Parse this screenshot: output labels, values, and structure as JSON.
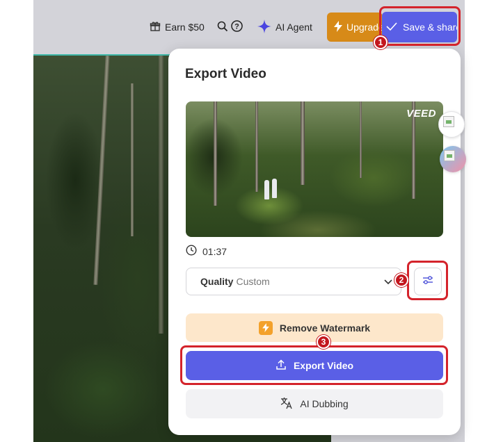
{
  "topbar": {
    "earn_label": "Earn $50",
    "ai_agent_label": "AI Agent",
    "upgrade_label": "Upgrade",
    "save_share_label": "Save & share"
  },
  "export_panel": {
    "title": "Export Video",
    "watermark_text": "VEED",
    "duration": "01:37",
    "quality_label": "Quality",
    "quality_value": "Custom",
    "remove_watermark_label": "Remove Watermark",
    "export_button_label": "Export Video",
    "ai_dubbing_label": "AI Dubbing"
  },
  "annotations": {
    "step1": "1",
    "step2": "2",
    "step3": "3"
  },
  "colors": {
    "accent": "#5a5fe6",
    "upgrade": "#d78a18",
    "highlight": "#d4232b",
    "watermark_bg": "#fde7cb"
  }
}
